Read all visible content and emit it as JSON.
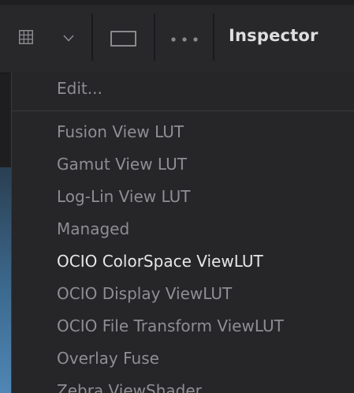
{
  "toolbar": {
    "title": "Inspector",
    "icons": [
      "grid-icon",
      "chevron-down-icon",
      "single-view-icon",
      "more-options-icon"
    ]
  },
  "menu": {
    "edit_label": "Edit...",
    "items": [
      {
        "label": "Fusion View LUT",
        "selected": false
      },
      {
        "label": "Gamut View LUT",
        "selected": false
      },
      {
        "label": "Log-Lin View LUT",
        "selected": false
      },
      {
        "label": "Managed",
        "selected": false
      },
      {
        "label": "OCIO ColorSpace ViewLUT",
        "selected": true
      },
      {
        "label": "OCIO Display ViewLUT",
        "selected": false
      },
      {
        "label": "OCIO File Transform ViewLUT",
        "selected": false
      },
      {
        "label": "Overlay Fuse",
        "selected": false
      },
      {
        "label": "Zebra ViewShader",
        "selected": false
      }
    ]
  },
  "colors": {
    "menu_background": "#262629",
    "item_text": "#8e8e93",
    "selected_text": "#e6e6e8",
    "title_text": "#dedee0"
  }
}
